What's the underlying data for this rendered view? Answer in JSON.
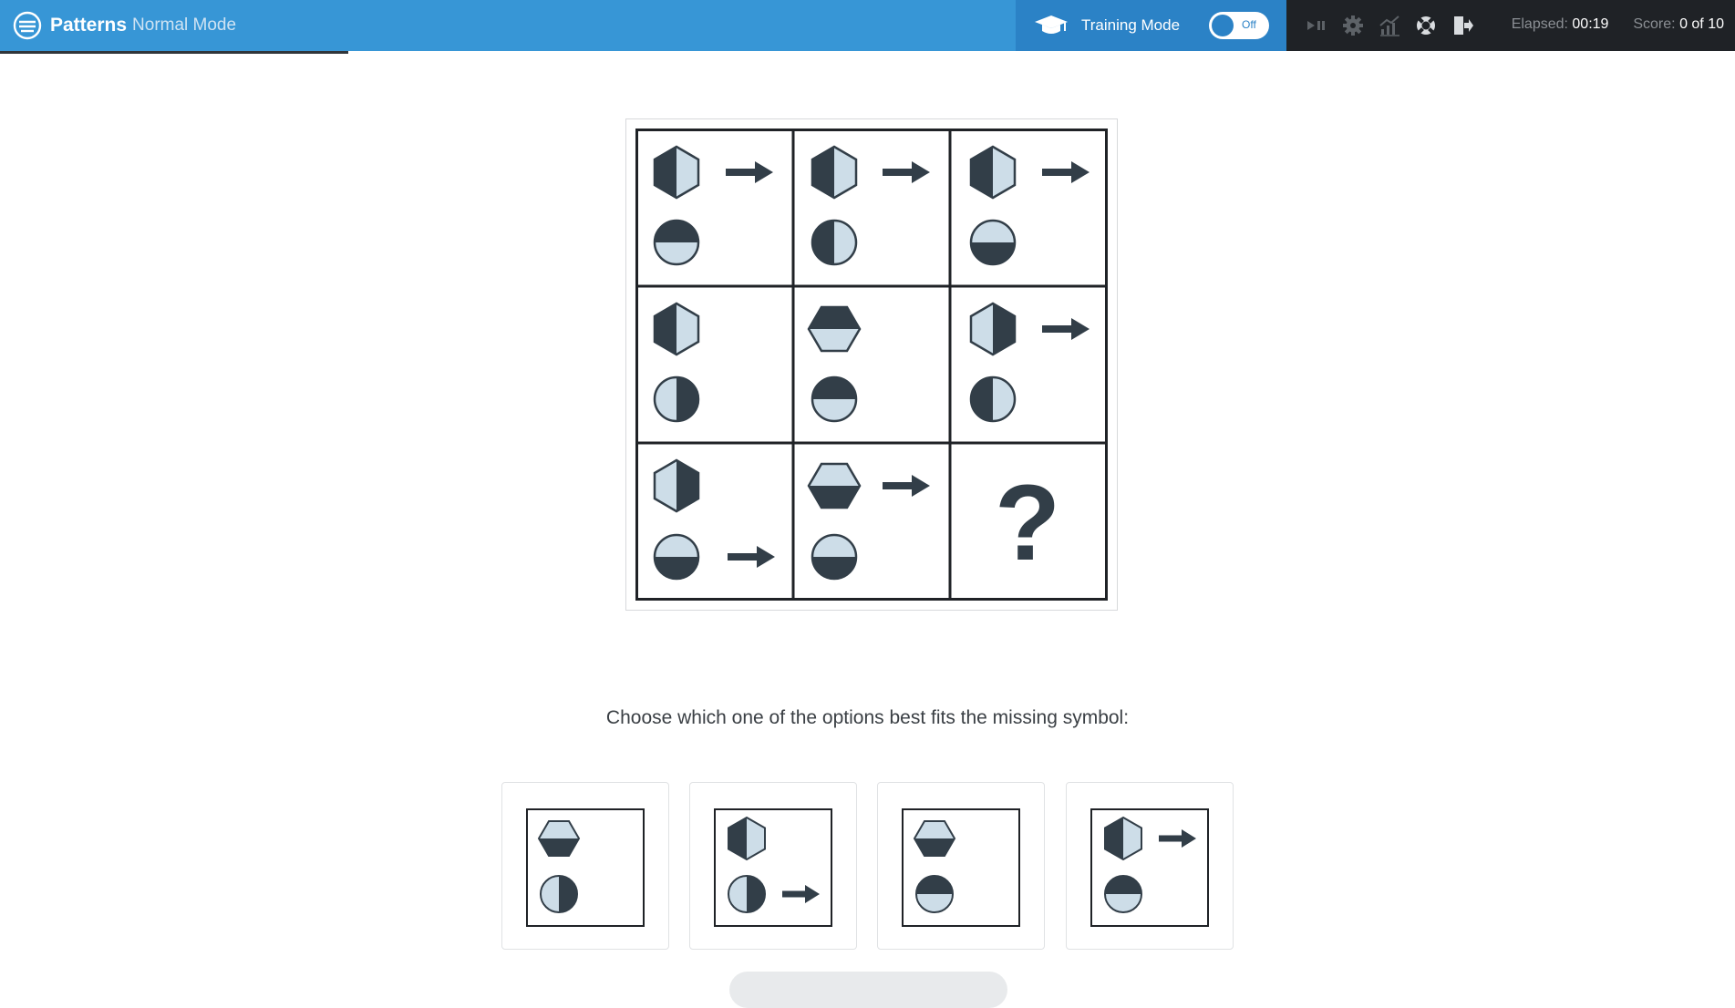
{
  "header": {
    "app_name": "Patterns",
    "mode_label": "Normal Mode",
    "training_label": "Training Mode",
    "toggle_state": "Off",
    "elapsed_label": "Elapsed:",
    "elapsed_value": "00:19",
    "score_label": "Score:",
    "score_value": "0 of 10",
    "tool_icons": [
      "play-pause-icon",
      "gear-icon",
      "stats-chart-icon",
      "help-lifebuoy-icon",
      "exit-icon"
    ],
    "colors": {
      "brand": "#3796d6",
      "training": "#2b82c6",
      "bar": "#1f2226"
    }
  },
  "puzzle": {
    "question_mark": "?",
    "colors": {
      "dark": "#323e48",
      "light": "#cddde8"
    }
  },
  "instruction": "Choose which one of the options best fits the missing symbol:",
  "options_count": 4
}
